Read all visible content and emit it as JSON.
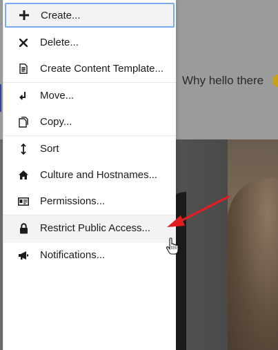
{
  "background": {
    "greeting": "Why hello there"
  },
  "menu": {
    "items": [
      {
        "label": "Create...",
        "icon": "plus-icon"
      },
      {
        "label": "Delete...",
        "icon": "close-icon"
      },
      {
        "label": "Create Content Template...",
        "icon": "document-template-icon"
      },
      {
        "label": "Move...",
        "icon": "move-arrow-icon"
      },
      {
        "label": "Copy...",
        "icon": "copy-icon"
      },
      {
        "label": "Sort",
        "icon": "sort-icon"
      },
      {
        "label": "Culture and Hostnames...",
        "icon": "home-icon"
      },
      {
        "label": "Permissions...",
        "icon": "id-card-icon"
      },
      {
        "label": "Restrict Public Access...",
        "icon": "lock-icon"
      },
      {
        "label": "Notifications...",
        "icon": "megaphone-icon"
      }
    ]
  },
  "colors": {
    "focus_border": "#78a9ec",
    "hover_bg": "#f3f3f5",
    "annotation_arrow": "#e02020"
  }
}
